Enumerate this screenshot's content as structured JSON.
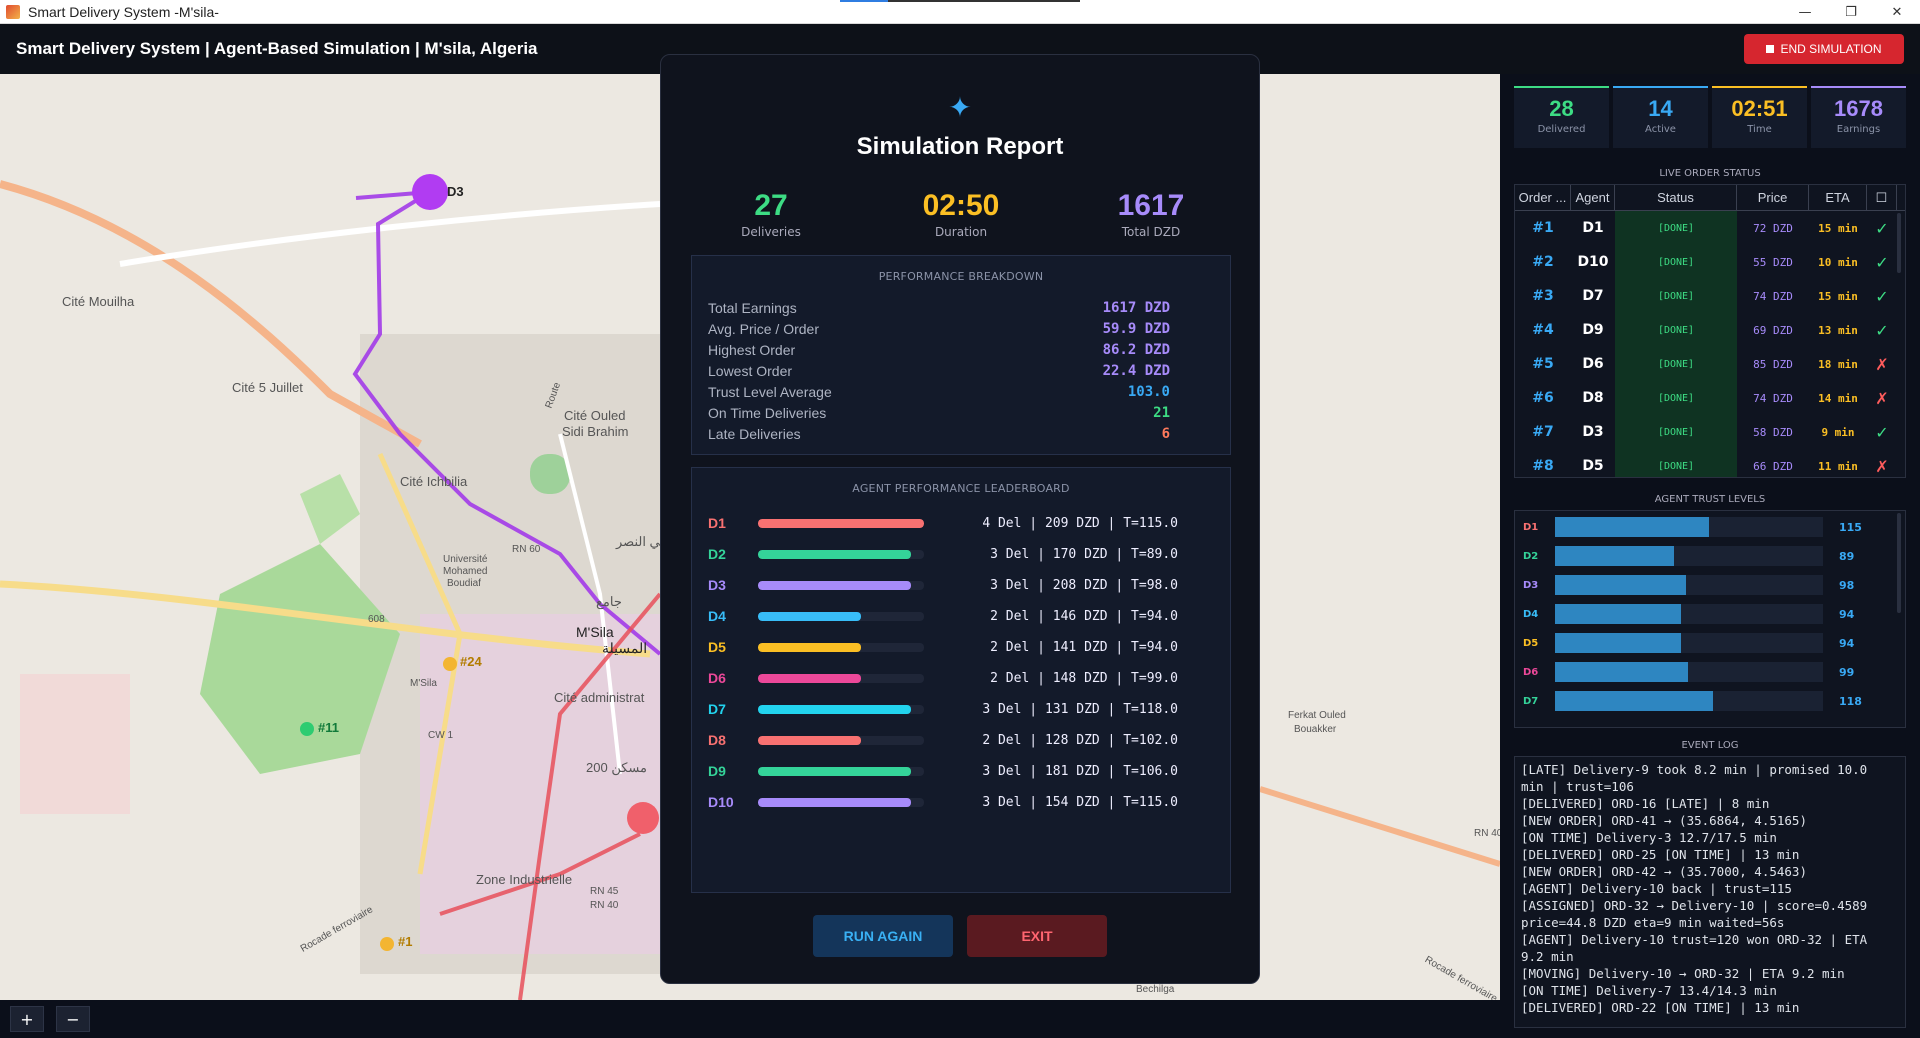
{
  "window": {
    "title": "Smart Delivery System -M'sila-",
    "minimize": "—",
    "restore": "❐",
    "close": "✕"
  },
  "app": {
    "title": "Smart Delivery System | Agent-Based Simulation | M'sila, Algeria",
    "end_button": "END SIMULATION"
  },
  "map": {
    "labels": {
      "cite_mouilha": "Cité Mouilha",
      "cite_5_juillet": "Cité 5 Juillet",
      "cite_ouled": "Cité Ouled",
      "sidi_brahim": "Sidi Brahim",
      "cite_ichbilia": "Cité Ichbilia",
      "universite": "Université",
      "mohamed": "Mohamed",
      "boudiaf": "Boudiaf",
      "msila": "M'Sila",
      "msila_city": "M'Sila",
      "msila_ar": "المسيلة",
      "cite_admin": "Cité administrat",
      "zone_industrielle": "Zone Industrielle",
      "ferkat_ouled": "Ferkat Ouled",
      "bouakker": "Bouakker",
      "rn60": "RN 60",
      "rn45": "RN 45",
      "rn40": "RN 40",
      "cw1": "CW 1",
      "rn_right": "RN 40",
      "rocade": "Rocade ferroviaire",
      "rocade2": "Rocade ferroviaire",
      "route": "Route",
      "no608": "608",
      "msila_2": "M'Sila",
      "ar_nasr": "حي النصر",
      "ar_jami": "جامع",
      "no200": "200 مسكن",
      "marker_d3": "D3",
      "marker_24": "#24",
      "marker_11": "#11",
      "marker_1": "#1",
      "bechilga": "Bechilga"
    },
    "zoom_in": "+",
    "zoom_out": "−"
  },
  "report": {
    "title": "Simulation Report",
    "sparkle": "✦",
    "summary": [
      {
        "value": "27",
        "label": "Deliveries",
        "color": "#3ddc84"
      },
      {
        "value": "02:50",
        "label": "Duration",
        "color": "#fbbf24"
      },
      {
        "value": "1617",
        "label": "Total DZD",
        "color": "#a78bfa"
      }
    ],
    "performance": {
      "heading": "PERFORMANCE BREAKDOWN",
      "rows": [
        {
          "label": "Total Earnings",
          "value": "1617 DZD",
          "color": "#a78bfa"
        },
        {
          "label": "Avg. Price / Order",
          "value": "59.9 DZD",
          "color": "#a78bfa"
        },
        {
          "label": "Highest Order",
          "value": "86.2 DZD",
          "color": "#a78bfa"
        },
        {
          "label": "Lowest Order",
          "value": "22.4 DZD",
          "color": "#a78bfa"
        },
        {
          "label": "Trust Level Average",
          "value": "103.0",
          "color": "#39a9f4"
        },
        {
          "label": "On Time Deliveries",
          "value": "21",
          "color": "#3ddc84"
        },
        {
          "label": "Late Deliveries",
          "value": "6",
          "color": "#ff7a5c"
        }
      ]
    },
    "leaderboard": {
      "heading": "AGENT PERFORMANCE LEADERBOARD",
      "rows": [
        {
          "agent": "D1",
          "color": "#f87171",
          "fill": 1.0,
          "text": "4 Del | 209 DZD | T=115.0"
        },
        {
          "agent": "D2",
          "color": "#34d399",
          "fill": 0.92,
          "text": "3 Del | 170 DZD | T=89.0"
        },
        {
          "agent": "D3",
          "color": "#a78bfa",
          "fill": 0.92,
          "text": "3 Del | 208 DZD | T=98.0"
        },
        {
          "agent": "D4",
          "color": "#38bdf8",
          "fill": 0.62,
          "text": "2 Del | 146 DZD | T=94.0"
        },
        {
          "agent": "D5",
          "color": "#fbbf24",
          "fill": 0.62,
          "text": "2 Del | 141 DZD | T=94.0"
        },
        {
          "agent": "D6",
          "color": "#ec4899",
          "fill": 0.62,
          "text": "2 Del | 148 DZD | T=99.0"
        },
        {
          "agent": "D7",
          "color": "#22d3ee",
          "fill": 0.92,
          "text": "3 Del | 131 DZD | T=118.0"
        },
        {
          "agent": "D8",
          "color": "#f87171",
          "fill": 0.62,
          "text": "2 Del | 128 DZD | T=102.0"
        },
        {
          "agent": "D9",
          "color": "#34d399",
          "fill": 0.92,
          "text": "3 Del | 181 DZD | T=106.0"
        },
        {
          "agent": "D10",
          "color": "#a78bfa",
          "fill": 0.92,
          "text": "3 Del | 154 DZD | T=115.0"
        }
      ]
    },
    "run_again": "RUN AGAIN",
    "exit": "EXIT"
  },
  "kpis": [
    {
      "value": "28",
      "label": "Delivered",
      "color": "#3ddc84"
    },
    {
      "value": "14",
      "label": "Active",
      "color": "#39a9f4"
    },
    {
      "value": "02:51",
      "label": "Time",
      "color": "#fbbf24"
    },
    {
      "value": "1678",
      "label": "Earnings",
      "color": "#a78bfa"
    }
  ],
  "orders": {
    "title": "LIVE ORDER STATUS",
    "columns": [
      "Order ...",
      "Agent",
      "Status",
      "Price",
      "ETA",
      "☐"
    ],
    "rows": [
      {
        "id": "#1",
        "agent": "D1",
        "status": "[DONE]",
        "price": "72 DZD",
        "eta": "15 min",
        "ok": "✓",
        "on_time": true
      },
      {
        "id": "#2",
        "agent": "D10",
        "status": "[DONE]",
        "price": "55 DZD",
        "eta": "10 min",
        "ok": "✓",
        "on_time": true
      },
      {
        "id": "#3",
        "agent": "D7",
        "status": "[DONE]",
        "price": "74 DZD",
        "eta": "15 min",
        "ok": "✓",
        "on_time": true
      },
      {
        "id": "#4",
        "agent": "D9",
        "status": "[DONE]",
        "price": "69 DZD",
        "eta": "13 min",
        "ok": "✓",
        "on_time": true
      },
      {
        "id": "#5",
        "agent": "D6",
        "status": "[DONE]",
        "price": "85 DZD",
        "eta": "18 min",
        "ok": "✗",
        "on_time": false
      },
      {
        "id": "#6",
        "agent": "D8",
        "status": "[DONE]",
        "price": "74 DZD",
        "eta": "14 min",
        "ok": "✗",
        "on_time": false
      },
      {
        "id": "#7",
        "agent": "D3",
        "status": "[DONE]",
        "price": "58 DZD",
        "eta": "9 min",
        "ok": "✓",
        "on_time": true
      },
      {
        "id": "#8",
        "agent": "D5",
        "status": "[DONE]",
        "price": "66 DZD",
        "eta": "11 min",
        "ok": "✗",
        "on_time": false
      }
    ]
  },
  "trust": {
    "title": "AGENT TRUST LEVELS",
    "rows": [
      {
        "agent": "D1",
        "value": "115",
        "level": 0.575,
        "color": "#f87171"
      },
      {
        "agent": "D2",
        "value": "89",
        "level": 0.445,
        "color": "#34d399"
      },
      {
        "agent": "D3",
        "value": "98",
        "level": 0.49,
        "color": "#a78bfa"
      },
      {
        "agent": "D4",
        "value": "94",
        "level": 0.47,
        "color": "#38bdf8"
      },
      {
        "agent": "D5",
        "value": "94",
        "level": 0.47,
        "color": "#fbbf24"
      },
      {
        "agent": "D6",
        "value": "99",
        "level": 0.495,
        "color": "#ec4899"
      },
      {
        "agent": "D7",
        "value": "118",
        "level": 0.59,
        "color": "#34d399"
      }
    ]
  },
  "event_log": {
    "title": "EVENT LOG",
    "lines": [
      "[LATE] Delivery-9 took 8.2 min | promised 10.0",
      "min | trust=106",
      "[DELIVERED] ORD-16 [LATE] | 8 min",
      "[NEW ORDER] ORD-41 → (35.6864, 4.5165)",
      "[ON TIME] Delivery-3 12.7/17.5 min",
      "[DELIVERED] ORD-25 [ON TIME] | 13 min",
      "[NEW ORDER] ORD-42 → (35.7000, 4.5463)",
      "[AGENT] Delivery-10 back | trust=115",
      "[ASSIGNED] ORD-32 → Delivery-10 | score=0.4589",
      "price=44.8 DZD eta=9 min waited=56s",
      "[AGENT] Delivery-10 trust=120 won ORD-32 | ETA",
      "9.2 min",
      "[MOVING] Delivery-10 → ORD-32 | ETA 9.2 min",
      "[ON TIME] Delivery-7 13.4/14.3 min",
      "[DELIVERED] ORD-22 [ON TIME] | 13 min"
    ]
  }
}
